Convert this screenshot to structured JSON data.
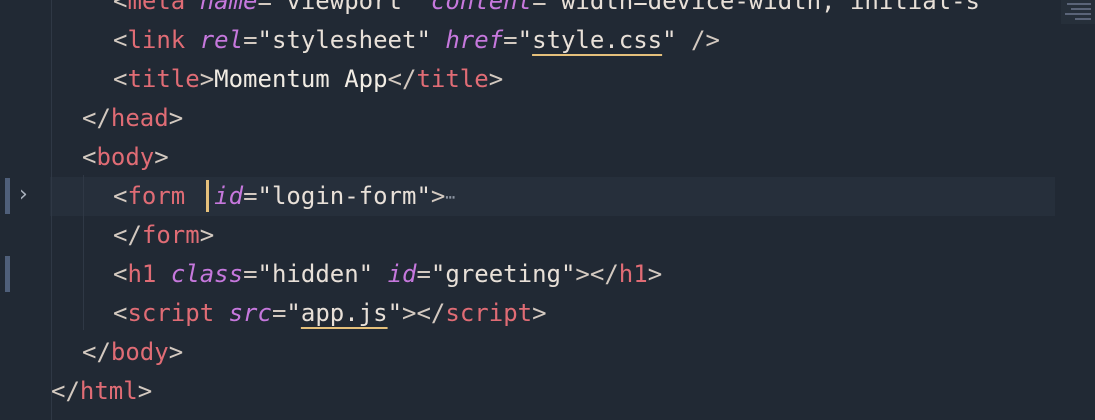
{
  "editor": {
    "lines": [
      {
        "id": "meta",
        "indent": 2,
        "parts": [
          {
            "t": "<",
            "c": "punct"
          },
          {
            "t": "meta",
            "c": "tag"
          },
          {
            "t": " ",
            "c": "text"
          },
          {
            "t": "name",
            "c": "attr"
          },
          {
            "t": "=",
            "c": "punct"
          },
          {
            "t": "\"viewport\"",
            "c": "str"
          },
          {
            "t": " ",
            "c": "text"
          },
          {
            "t": "content",
            "c": "attr"
          },
          {
            "t": "=",
            "c": "punct"
          },
          {
            "t": "\"width=device-width, initial-s",
            "c": "str"
          }
        ]
      },
      {
        "id": "link",
        "indent": 2,
        "parts": [
          {
            "t": "<",
            "c": "punct"
          },
          {
            "t": "link",
            "c": "tag"
          },
          {
            "t": " ",
            "c": "text"
          },
          {
            "t": "rel",
            "c": "attr"
          },
          {
            "t": "=",
            "c": "punct"
          },
          {
            "t": "\"stylesheet\"",
            "c": "str"
          },
          {
            "t": " ",
            "c": "text"
          },
          {
            "t": "href",
            "c": "attr"
          },
          {
            "t": "=",
            "c": "punct"
          },
          {
            "t": "\"",
            "c": "str"
          },
          {
            "t": "style.css",
            "c": "str link-u"
          },
          {
            "t": "\"",
            "c": "str"
          },
          {
            "t": " />",
            "c": "punct"
          }
        ]
      },
      {
        "id": "title",
        "indent": 2,
        "parts": [
          {
            "t": "<",
            "c": "punct"
          },
          {
            "t": "title",
            "c": "tag"
          },
          {
            "t": ">",
            "c": "punct"
          },
          {
            "t": "Momentum App",
            "c": "text"
          },
          {
            "t": "</",
            "c": "punct"
          },
          {
            "t": "title",
            "c": "tag"
          },
          {
            "t": ">",
            "c": "punct"
          }
        ]
      },
      {
        "id": "head-close",
        "indent": 1,
        "parts": [
          {
            "t": "</",
            "c": "punct"
          },
          {
            "t": "head",
            "c": "tag"
          },
          {
            "t": ">",
            "c": "punct"
          }
        ]
      },
      {
        "id": "body-open",
        "indent": 1,
        "parts": [
          {
            "t": "<",
            "c": "punct"
          },
          {
            "t": "body",
            "c": "tag"
          },
          {
            "t": ">",
            "c": "punct"
          }
        ]
      },
      {
        "id": "form-open",
        "indent": 2,
        "active": true,
        "parts": [
          {
            "t": "<",
            "c": "punct"
          },
          {
            "t": "form",
            "c": "tag"
          },
          {
            "t": "  ",
            "c": "text"
          },
          {
            "t": "id",
            "c": "attr"
          },
          {
            "t": "=",
            "c": "punct"
          },
          {
            "t": "\"login-form\"",
            "c": "str"
          },
          {
            "t": ">",
            "c": "punct"
          },
          {
            "t": "⋯",
            "c": "ellipsis"
          }
        ]
      },
      {
        "id": "form-close",
        "indent": 2,
        "parts": [
          {
            "t": "</",
            "c": "punct"
          },
          {
            "t": "form",
            "c": "tag"
          },
          {
            "t": ">",
            "c": "punct"
          }
        ]
      },
      {
        "id": "h1",
        "indent": 2,
        "parts": [
          {
            "t": "<",
            "c": "punct"
          },
          {
            "t": "h1",
            "c": "tag"
          },
          {
            "t": " ",
            "c": "text"
          },
          {
            "t": "class",
            "c": "attr"
          },
          {
            "t": "=",
            "c": "punct"
          },
          {
            "t": "\"hidden\"",
            "c": "str"
          },
          {
            "t": " ",
            "c": "text"
          },
          {
            "t": "id",
            "c": "attr"
          },
          {
            "t": "=",
            "c": "punct"
          },
          {
            "t": "\"greeting\"",
            "c": "str"
          },
          {
            "t": "></",
            "c": "punct"
          },
          {
            "t": "h1",
            "c": "tag"
          },
          {
            "t": ">",
            "c": "punct"
          }
        ]
      },
      {
        "id": "script",
        "indent": 2,
        "parts": [
          {
            "t": "<",
            "c": "punct"
          },
          {
            "t": "script",
            "c": "tag"
          },
          {
            "t": " ",
            "c": "text"
          },
          {
            "t": "src",
            "c": "attr"
          },
          {
            "t": "=",
            "c": "punct"
          },
          {
            "t": "\"",
            "c": "str"
          },
          {
            "t": "app.js",
            "c": "str link-u"
          },
          {
            "t": "\"",
            "c": "str"
          },
          {
            "t": "></",
            "c": "punct"
          },
          {
            "t": "script",
            "c": "tag"
          },
          {
            "t": ">",
            "c": "punct"
          }
        ]
      },
      {
        "id": "body-close",
        "indent": 1,
        "parts": [
          {
            "t": "</",
            "c": "punct"
          },
          {
            "t": "body",
            "c": "tag"
          },
          {
            "t": ">",
            "c": "punct"
          }
        ]
      },
      {
        "id": "html-close",
        "indent": 0,
        "parts": [
          {
            "t": "</",
            "c": "punct"
          },
          {
            "t": "html",
            "c": "tag"
          },
          {
            "t": ">",
            "c": "punct"
          }
        ]
      }
    ],
    "fold_icon": "chevron-right-icon",
    "fold_glyph": "›"
  },
  "colors": {
    "background": "#212934",
    "tag": "#e06c75",
    "attribute": "#c678dd",
    "string": "#e8e0d8",
    "cursor": "#e5c07b"
  }
}
